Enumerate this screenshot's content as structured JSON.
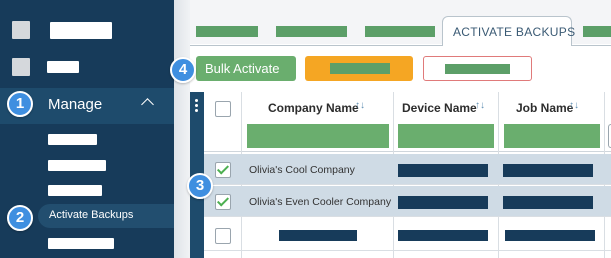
{
  "sidebar": {
    "manage_label": "Manage",
    "active_item_label": "Activate Backups"
  },
  "tabs": {
    "active_label": "ACTIVATE BACKUPS"
  },
  "toolbar": {
    "bulk_activate_label": "Bulk Activate"
  },
  "table": {
    "columns": [
      "Company Name",
      "Device Name",
      "Job Name"
    ],
    "sort_glyph": "↑↓",
    "rows": [
      {
        "company": "Olivia's Cool Company",
        "checked": true,
        "selected": true
      },
      {
        "company": "Olivia's Even Cooler Company",
        "checked": true,
        "selected": true
      },
      {
        "company": "",
        "checked": false,
        "selected": false
      }
    ]
  },
  "badges": [
    "1",
    "2",
    "3",
    "4"
  ],
  "colors": {
    "sidebar_bg": "#173b5a",
    "redaction_green": "#5c9f68",
    "bulk_button": "#6aae6e",
    "orange_button": "#f5a623",
    "badge_blue": "#3f8fe0",
    "selected_row": "#cfdbe5"
  }
}
